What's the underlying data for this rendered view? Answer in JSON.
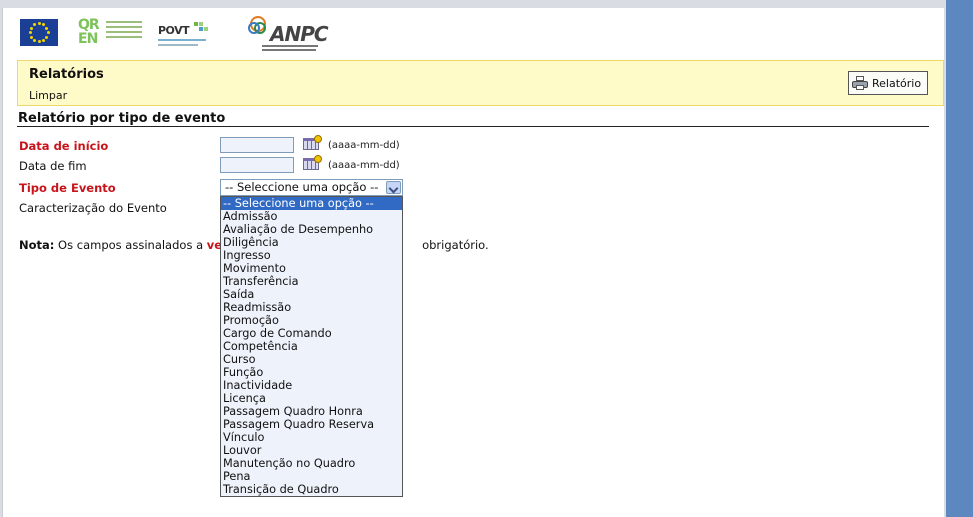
{
  "logos": {
    "povt_text": "POVT",
    "anpc_text": "ANPC"
  },
  "header": {
    "title": "Relatórios",
    "clear_label": "Limpar",
    "report_button_label": "Relatório"
  },
  "section_title": "Relatório por tipo de evento",
  "form": {
    "start_date_label": "Data de início",
    "end_date_label": "Data de fim",
    "date_format_hint": "(aaaa-mm-dd)",
    "event_type_label": "Tipo de Evento",
    "event_characterization_label": "Caracterização do Evento",
    "event_type_selected": "-- Seleccione uma opção --"
  },
  "note": {
    "prefix": "Nota:",
    "text_before": "Os campos assinalados a",
    "highlight": "ve",
    "text_after": "obrigatório."
  },
  "event_type_options": [
    "-- Seleccione uma opção --",
    "Admissão",
    "Avaliação de Desempenho",
    "Diligência",
    "Ingresso",
    "Movimento",
    "Transferência",
    "Saída",
    "Readmissão",
    "Promoção",
    "Cargo de Comando",
    "Competência",
    "Curso",
    "Função",
    "Inactividade",
    "Licença",
    "Passagem Quadro Honra",
    "Passagem Quadro Reserva",
    "Vínculo",
    "Louvor",
    "Manutenção no Quadro",
    "Pena",
    "Transição de Quadro"
  ],
  "colors": {
    "required_label": "#c8141b",
    "header_bg": "#fffbc9",
    "selected_option_bg": "#316ac5",
    "side_bar": "#5d87bf"
  }
}
